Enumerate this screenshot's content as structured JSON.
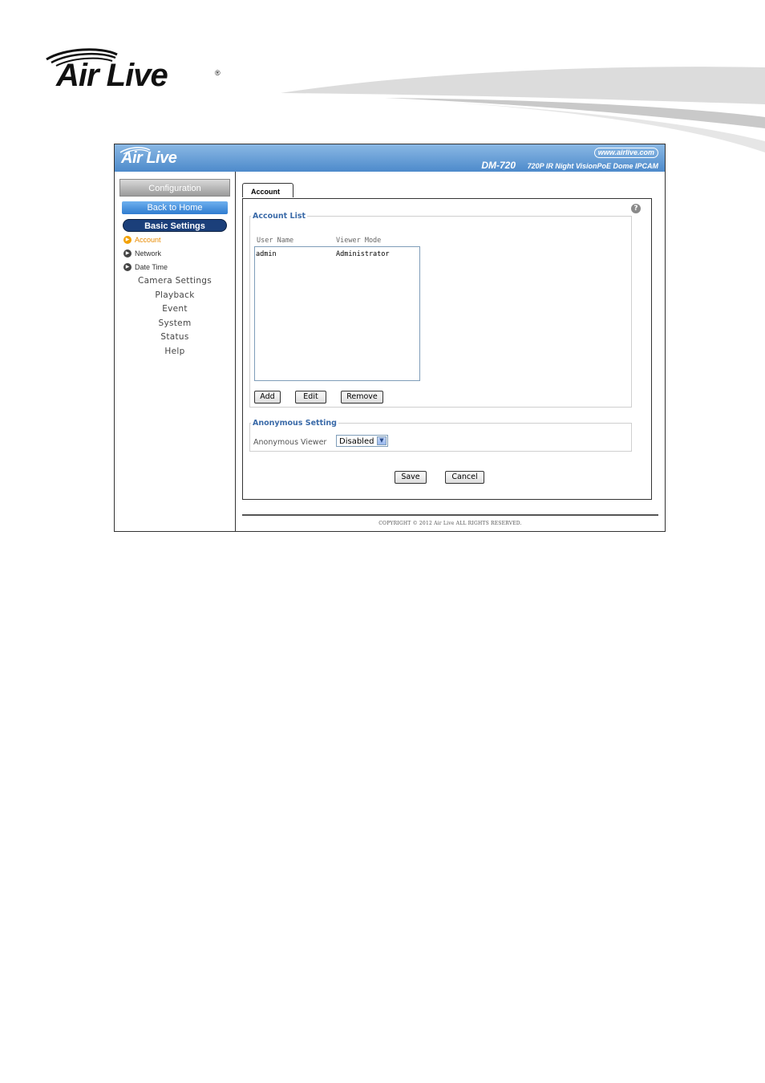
{
  "brand": {
    "logo_text": "Air Live",
    "registered_mark": "®"
  },
  "banner": {
    "logo_text": "Air Live",
    "url": "www.airlive.com",
    "model": "DM-720",
    "description": "720P IR Night VisionPoE Dome IPCAM",
    "color": "#4d8acb"
  },
  "sidebar": {
    "configuration": "Configuration",
    "back_home": "Back to Home",
    "basic_settings": "Basic Settings",
    "sub_items": [
      {
        "label": "Account",
        "active": true
      },
      {
        "label": "Network",
        "active": false
      },
      {
        "label": "Date Time",
        "active": false
      }
    ],
    "main_items": [
      {
        "label": "Camera Settings"
      },
      {
        "label": "Playback"
      },
      {
        "label": "Event"
      },
      {
        "label": "System"
      },
      {
        "label": "Status"
      },
      {
        "label": "Help"
      }
    ]
  },
  "tab": {
    "label": "Account"
  },
  "account_list": {
    "legend": "Account List",
    "columns": [
      "User Name",
      "Viewer Mode"
    ],
    "rows": [
      {
        "user": "admin",
        "mode": "Administrator"
      }
    ],
    "buttons": {
      "add": "Add",
      "edit": "Edit",
      "remove": "Remove"
    }
  },
  "anonymous": {
    "legend": "Anonymous Setting",
    "label": "Anonymous Viewer",
    "selected": "Disabled"
  },
  "actions": {
    "save": "Save",
    "cancel": "Cancel"
  },
  "footer": {
    "copyright": "COPYRIGHT © 2012 Air Live ALL RIGHTS RESERVED."
  },
  "icons": {
    "help": "help-icon",
    "dropdown": "chevron-down-icon",
    "bullet": "play-bullet-icon"
  }
}
